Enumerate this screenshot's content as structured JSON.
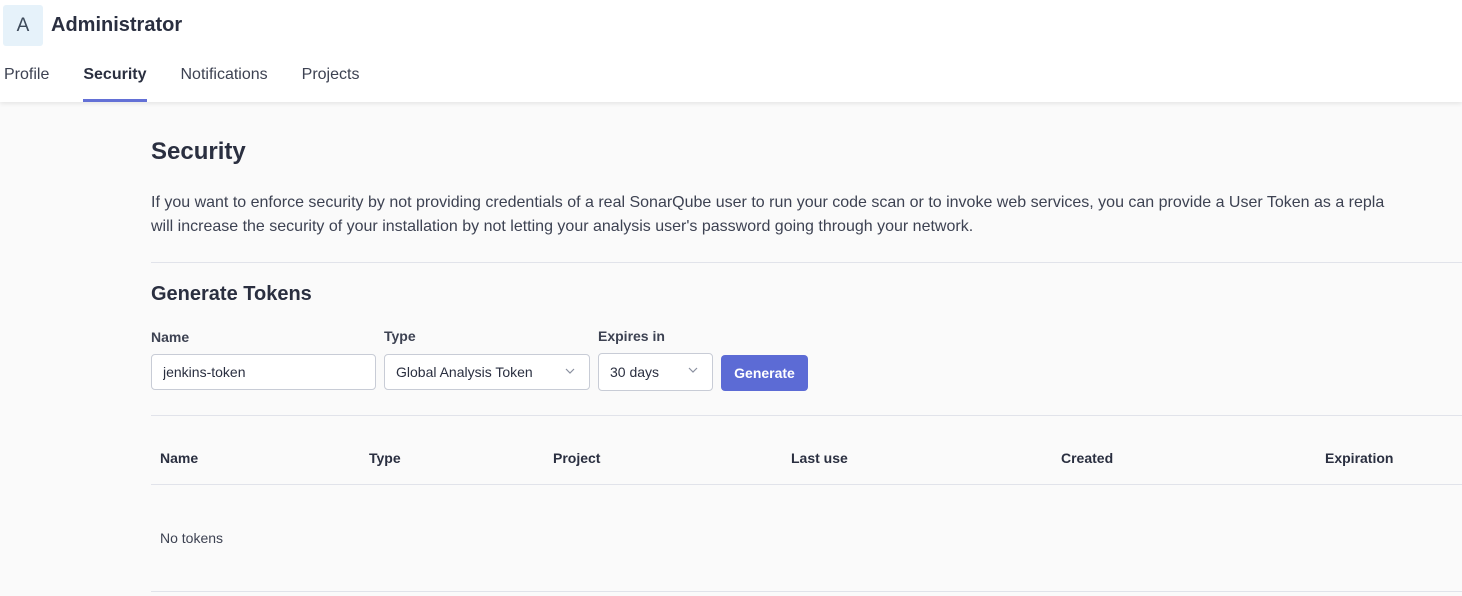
{
  "user": {
    "avatar_letter": "A",
    "name": "Administrator"
  },
  "tabs": [
    {
      "label": "Profile"
    },
    {
      "label": "Security",
      "active": true
    },
    {
      "label": "Notifications"
    },
    {
      "label": "Projects"
    }
  ],
  "page": {
    "title": "Security",
    "description_line1": "If you want to enforce security by not providing credentials of a real SonarQube user to run your code scan or to invoke web services, you can provide a User Token as a repla",
    "description_line2": "will increase the security of your installation by not letting your analysis user's password going through your network."
  },
  "generate": {
    "section_title": "Generate Tokens",
    "name_label": "Name",
    "name_value": "jenkins-token",
    "type_label": "Type",
    "type_value": "Global Analysis Token",
    "expires_label": "Expires in",
    "expires_value": "30 days",
    "button_label": "Generate"
  },
  "table": {
    "columns": [
      "Name",
      "Type",
      "Project",
      "Last use",
      "Created",
      "Expiration"
    ],
    "empty_text": "No tokens"
  },
  "colors": {
    "accent": "#5c6bd5",
    "tab_underline": "#6370d6",
    "avatar_bg": "#e6f2fa"
  }
}
